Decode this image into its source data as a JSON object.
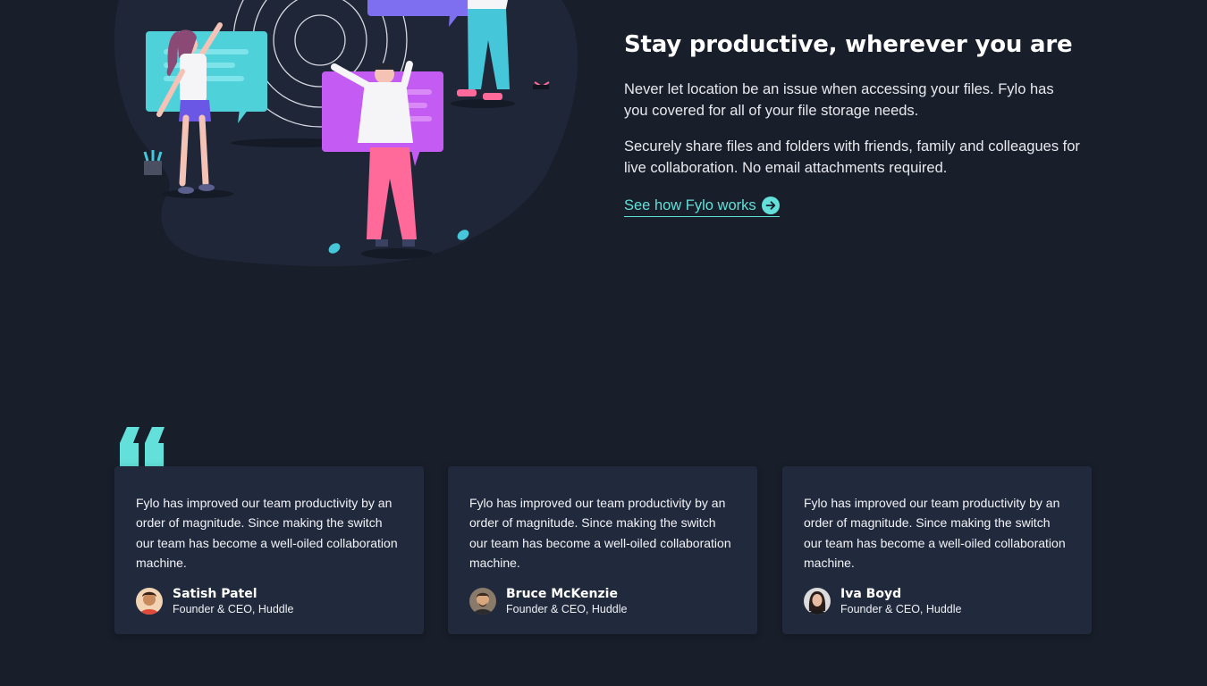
{
  "productive": {
    "heading": "Stay productive, wherever you are",
    "paragraph_1": "Never let location be an issue when accessing your files. Fylo has you covered for all of your file storage needs.",
    "paragraph_2": "Securely share files and folders with friends, family and colleagues for live collaboration. No email attachments required.",
    "link_label": "See how Fylo works",
    "link_icon": "arrow-right-circle-icon"
  },
  "testimonials": [
    {
      "quote": "Fylo has improved our team productivity by an order of magnitude. Since making the switch our team has become a well-oiled collaboration machine.",
      "name": "Satish Patel",
      "role": "Founder & CEO, Huddle"
    },
    {
      "quote": "Fylo has improved our team productivity by an order of magnitude. Since making the switch our team has become a well-oiled collaboration machine.",
      "name": "Bruce McKenzie",
      "role": "Founder & CEO, Huddle"
    },
    {
      "quote": "Fylo has improved our team productivity by an order of magnitude. Since making the switch our team has become a well-oiled collaboration machine.",
      "name": "Iva Boyd",
      "role": "Founder & CEO, Huddle"
    }
  ],
  "colors": {
    "background": "#181e2a",
    "card": "#212a3d",
    "accent_cyan": "#62e0d9"
  }
}
